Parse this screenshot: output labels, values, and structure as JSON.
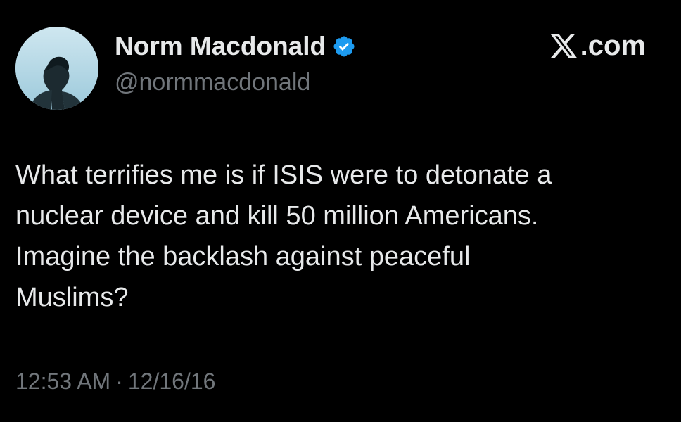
{
  "author": {
    "display_name": "Norm Macdonald",
    "handle": "@normmacdonald",
    "verified": true
  },
  "brand": {
    "icon": "x-logo-icon",
    "text": ".com"
  },
  "tweet": {
    "text": "What terrifies me is if ISIS were to detonate a\nnuclear device and kill 50 million Americans.\nImagine the backlash against peaceful\nMuslims?",
    "time": "12:53 AM",
    "separator": "·",
    "date": "12/16/16"
  },
  "colors": {
    "background": "#000000",
    "text": "#e7e9ea",
    "secondary_text": "#71767b",
    "verified_badge": "#1d9bf0"
  }
}
